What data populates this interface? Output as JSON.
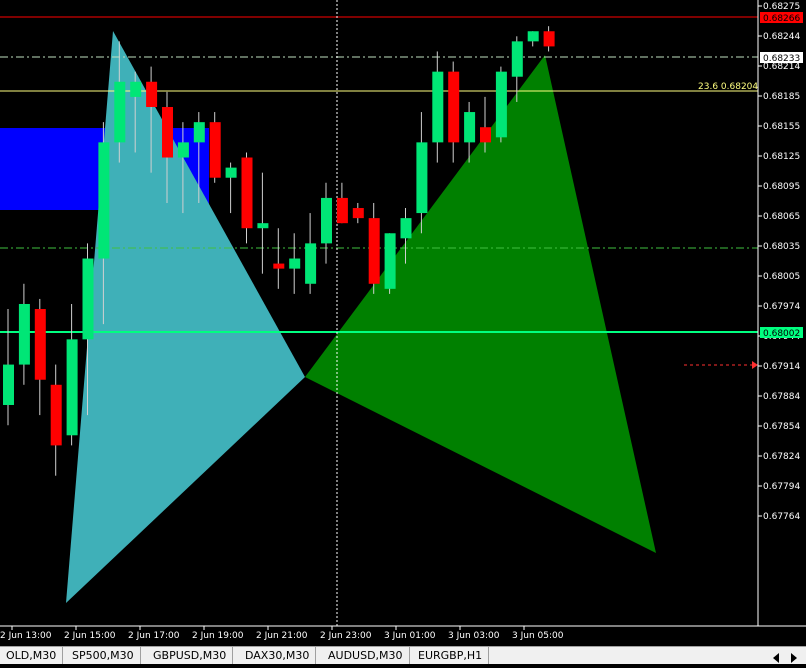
{
  "chart_data": {
    "type": "candlestick",
    "price_axis": [
      "0.68275",
      "0.68244",
      "0.68214",
      "0.68185",
      "0.68155",
      "0.68125",
      "0.68095",
      "0.68065",
      "0.68035",
      "0.68005",
      "0.67974",
      "0.67944",
      "0.67914",
      "0.67884",
      "0.67854",
      "0.67824",
      "0.67794",
      "0.67764"
    ],
    "time_axis": [
      "2 Jun 13:00",
      "2 Jun 15:00",
      "2 Jun 17:00",
      "2 Jun 19:00",
      "2 Jun 21:00",
      "2 Jun 23:00",
      "3 Jun 01:00",
      "3 Jun 03:00",
      "3 Jun 05:00"
    ],
    "candles": [
      {
        "o": 0.6788,
        "h": 0.67975,
        "l": 0.6786,
        "c": 0.6792
      },
      {
        "o": 0.6792,
        "h": 0.68,
        "l": 0.679,
        "c": 0.6798
      },
      {
        "o": 0.67975,
        "h": 0.67985,
        "l": 0.6787,
        "c": 0.67905
      },
      {
        "o": 0.679,
        "h": 0.6792,
        "l": 0.6781,
        "c": 0.6784
      },
      {
        "o": 0.6785,
        "h": 0.6798,
        "l": 0.6784,
        "c": 0.67945
      },
      {
        "o": 0.67945,
        "h": 0.6804,
        "l": 0.6787,
        "c": 0.68025
      },
      {
        "o": 0.68025,
        "h": 0.6816,
        "l": 0.6796,
        "c": 0.6814
      },
      {
        "o": 0.6814,
        "h": 0.6824,
        "l": 0.6812,
        "c": 0.682
      },
      {
        "o": 0.68185,
        "h": 0.6821,
        "l": 0.6813,
        "c": 0.682
      },
      {
        "o": 0.682,
        "h": 0.68215,
        "l": 0.6811,
        "c": 0.68175
      },
      {
        "o": 0.68175,
        "h": 0.6819,
        "l": 0.6808,
        "c": 0.68125
      },
      {
        "o": 0.68125,
        "h": 0.6816,
        "l": 0.6807,
        "c": 0.6814
      },
      {
        "o": 0.6814,
        "h": 0.6817,
        "l": 0.6808,
        "c": 0.6816
      },
      {
        "o": 0.6816,
        "h": 0.6817,
        "l": 0.681,
        "c": 0.68105
      },
      {
        "o": 0.68105,
        "h": 0.6812,
        "l": 0.6807,
        "c": 0.68115
      },
      {
        "o": 0.68125,
        "h": 0.6813,
        "l": 0.6804,
        "c": 0.68055
      },
      {
        "o": 0.68055,
        "h": 0.6811,
        "l": 0.6801,
        "c": 0.6806
      },
      {
        "o": 0.6802,
        "h": 0.68055,
        "l": 0.67995,
        "c": 0.68015
      },
      {
        "o": 0.68015,
        "h": 0.6805,
        "l": 0.6799,
        "c": 0.68025
      },
      {
        "o": 0.68,
        "h": 0.6807,
        "l": 0.6799,
        "c": 0.6804
      },
      {
        "o": 0.6804,
        "h": 0.681,
        "l": 0.6802,
        "c": 0.68085
      },
      {
        "o": 0.68085,
        "h": 0.681,
        "l": 0.6806,
        "c": 0.6806
      },
      {
        "o": 0.68075,
        "h": 0.6808,
        "l": 0.6806,
        "c": 0.68065
      },
      {
        "o": 0.68065,
        "h": 0.6808,
        "l": 0.6799,
        "c": 0.68
      },
      {
        "o": 0.67995,
        "h": 0.6805,
        "l": 0.6799,
        "c": 0.6805
      },
      {
        "o": 0.68045,
        "h": 0.68075,
        "l": 0.6802,
        "c": 0.68065
      },
      {
        "o": 0.6807,
        "h": 0.6817,
        "l": 0.6805,
        "c": 0.6814
      },
      {
        "o": 0.6814,
        "h": 0.6823,
        "l": 0.6812,
        "c": 0.6821
      },
      {
        "o": 0.6821,
        "h": 0.6822,
        "l": 0.6812,
        "c": 0.6814
      },
      {
        "o": 0.6814,
        "h": 0.6818,
        "l": 0.6812,
        "c": 0.6817
      },
      {
        "o": 0.68155,
        "h": 0.68185,
        "l": 0.6813,
        "c": 0.6814
      },
      {
        "o": 0.68145,
        "h": 0.68215,
        "l": 0.6814,
        "c": 0.6821
      },
      {
        "o": 0.68205,
        "h": 0.68245,
        "l": 0.6818,
        "c": 0.6824
      },
      {
        "o": 0.6824,
        "h": 0.6825,
        "l": 0.68235,
        "c": 0.6825
      },
      {
        "o": 0.6825,
        "h": 0.68255,
        "l": 0.6823,
        "c": 0.68235
      }
    ],
    "price_labels": [
      {
        "text": "0.68266",
        "value": 0.68266,
        "bg": "#ff0000",
        "fg": "#000000"
      },
      {
        "text": "0.68233",
        "value": 0.68233,
        "bg": "#ffffff",
        "fg": "#000000"
      },
      {
        "text": "0.68002",
        "value": 0.68002,
        "bg": "#00ff80",
        "fg": "#000000"
      }
    ],
    "fib": {
      "level": "23.6",
      "price": "0.68204",
      "value": 0.68204
    },
    "dashdot_levels": [
      0.68233,
      0.68071
    ],
    "bullish_color": "#00e676",
    "bearish_color": "#ff0000",
    "wick_color": "#d0d0d0",
    "pattern_left_color": "#3fb0b8",
    "pattern_right_color": "#008000",
    "zone_color": "#0000ff"
  },
  "tabs": [
    "OLD,M30",
    "SP500,M30",
    "GBPUSD,M30",
    "DAX30,M30",
    "AUDUSD,M30",
    "EURGBP,H1"
  ],
  "icons": {
    "nav_left": "triangle-left-icon",
    "nav_right": "triangle-right-icon"
  }
}
